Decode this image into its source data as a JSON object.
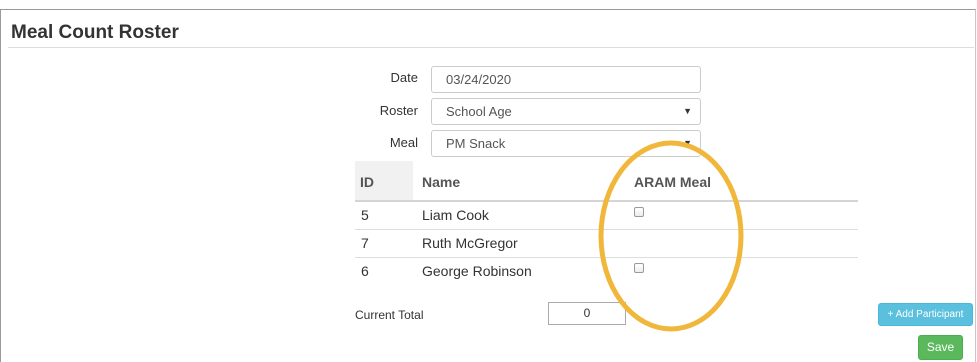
{
  "page": {
    "title": "Meal Count Roster"
  },
  "form": {
    "date_label": "Date",
    "date_value": "03/24/2020",
    "roster_label": "Roster",
    "roster_value": "School Age",
    "meal_label": "Meal",
    "meal_value": "PM Snack"
  },
  "table": {
    "headers": {
      "id": "ID",
      "name": "Name",
      "aram": "ARAM Meal"
    },
    "rows": [
      {
        "id": "5",
        "name": "Liam Cook",
        "aram_checkbox": true,
        "checked": false
      },
      {
        "id": "7",
        "name": "Ruth McGregor",
        "aram_checkbox": false,
        "checked": false
      },
      {
        "id": "6",
        "name": "George Robinson",
        "aram_checkbox": true,
        "checked": false
      }
    ]
  },
  "footer": {
    "total_label": "Current Total",
    "total_value": "0",
    "add_participant_label": "+ Add Participant",
    "save_label": "Save"
  },
  "annotation": {
    "highlight_color": "#F0B73A"
  }
}
